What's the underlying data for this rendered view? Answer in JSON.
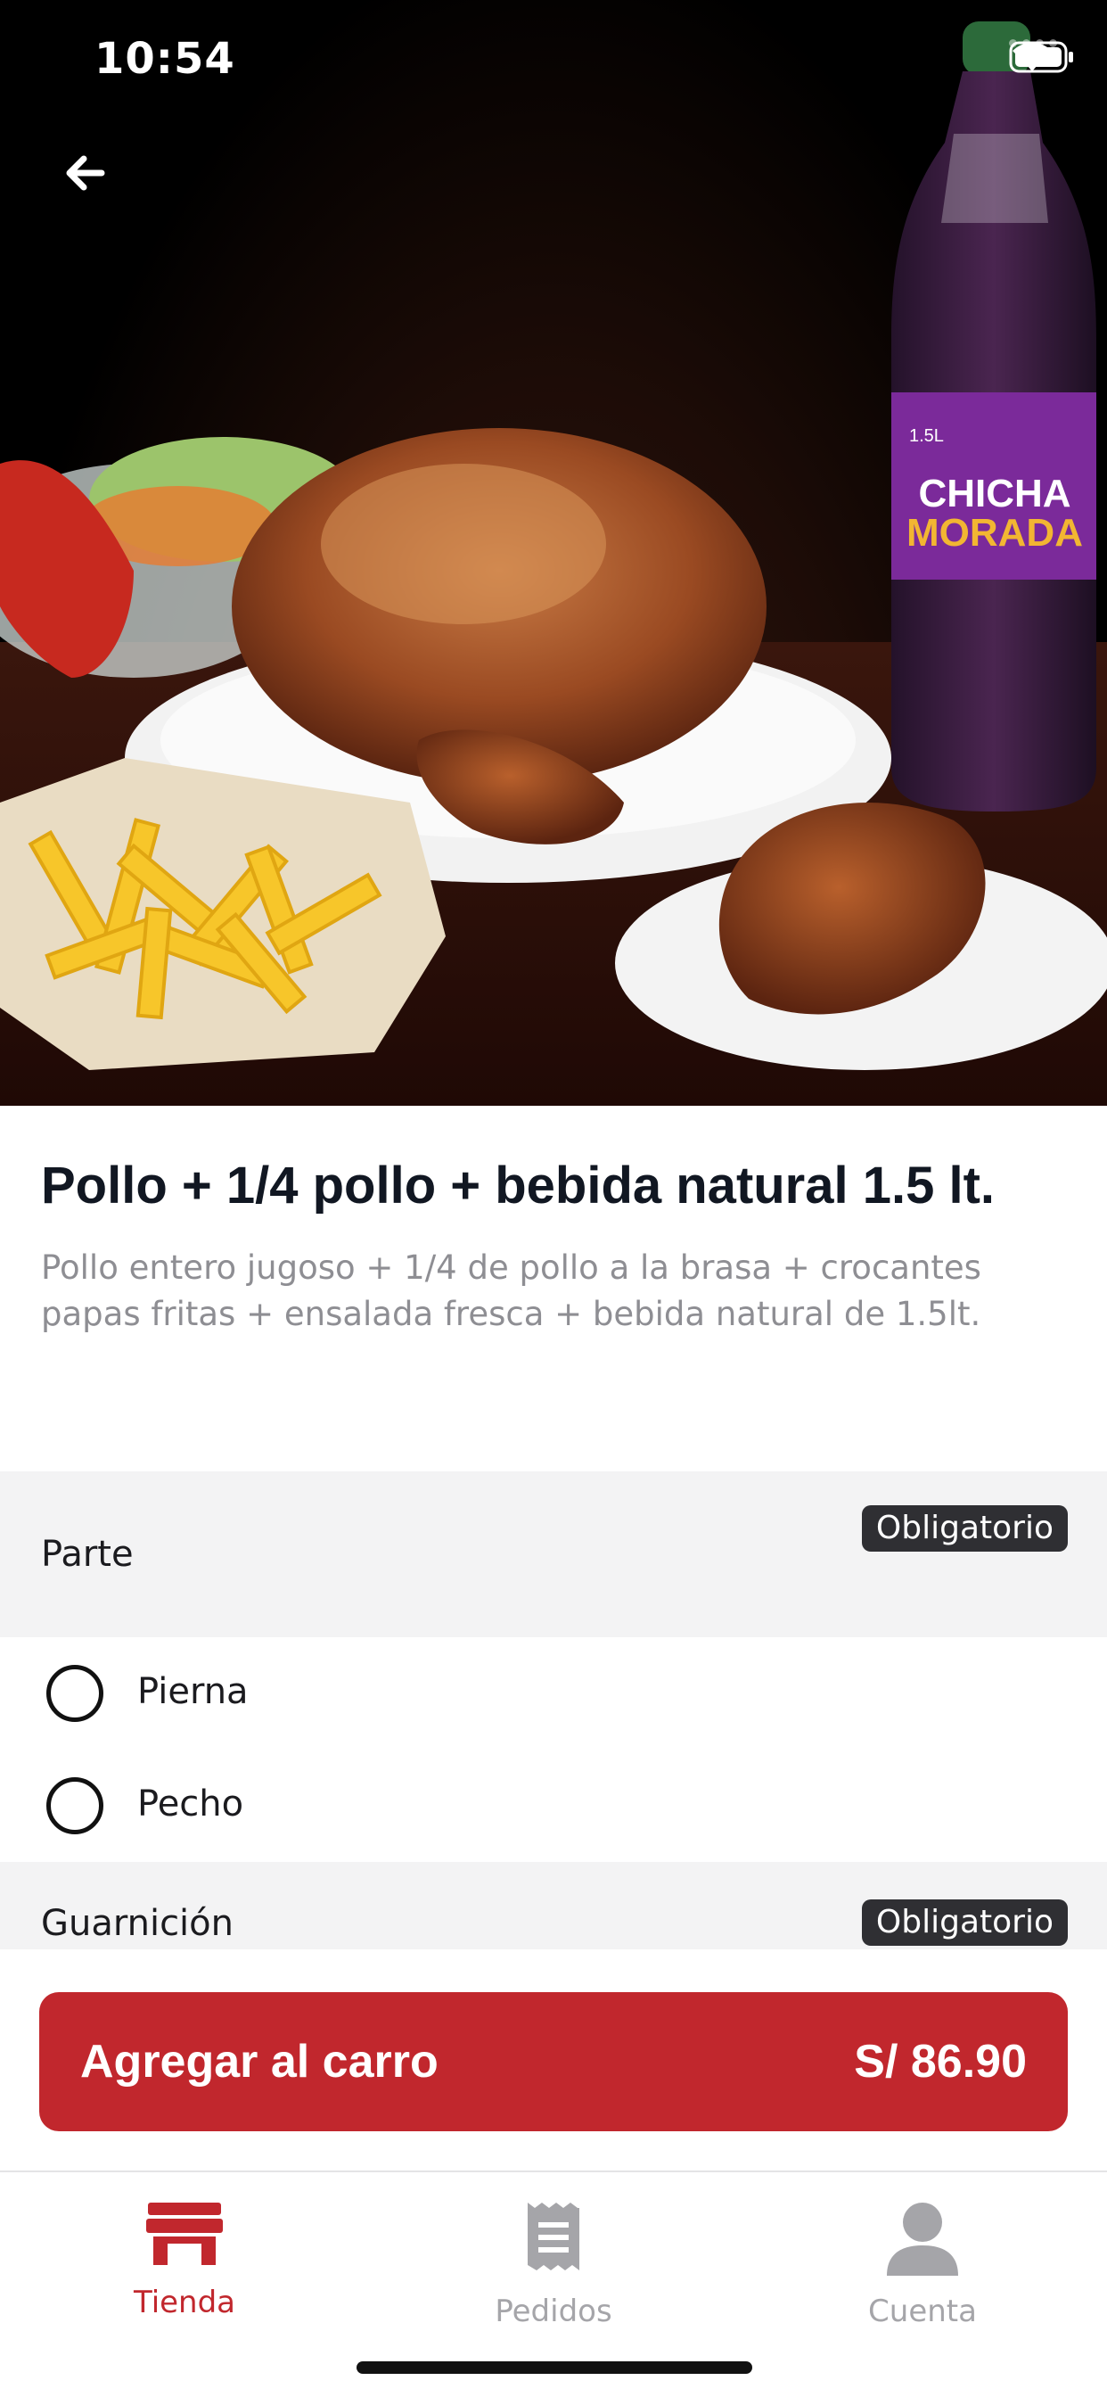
{
  "status_bar": {
    "time": "10:54"
  },
  "hero": {
    "image_subject": "pollo a la brasa con papas fritas, ensalada y chicha morada",
    "bottle_label_line1": "CHICHA",
    "bottle_label_line2": "MORADA",
    "bottle_size": "1.5L"
  },
  "product": {
    "title": "Pollo + 1/4 pollo + bebida natural 1.5 lt.",
    "description": "Pollo entero jugoso + 1/4 de pollo a la brasa + crocantes papas fritas + ensalada fresca + bebida natural de 1.5lt."
  },
  "sections": [
    {
      "title": "Parte",
      "badge": "Obligatorio",
      "options": [
        {
          "label": "Pierna",
          "selected": false
        },
        {
          "label": "Pecho",
          "selected": false
        }
      ]
    },
    {
      "title": "Guarnición",
      "badge": "Obligatorio"
    }
  ],
  "cart": {
    "label": "Agregar al carro",
    "price": "S/ 86.90"
  },
  "tabs": [
    {
      "label": "Tienda",
      "icon": "store-icon",
      "active": true
    },
    {
      "label": "Pedidos",
      "icon": "receipt-icon",
      "active": false
    },
    {
      "label": "Cuenta",
      "icon": "user-icon",
      "active": false
    }
  ],
  "colors": {
    "accent": "#c1272d",
    "badge_bg": "#2f2f33",
    "section_bg": "#f3f3f4",
    "text_primary": "#111722",
    "text_secondary": "#8e8e93"
  }
}
